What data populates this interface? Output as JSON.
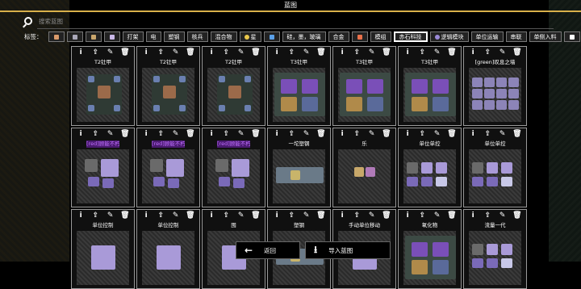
{
  "window": {
    "title": "蓝图"
  },
  "search": {
    "placeholder": "搜索蓝图"
  },
  "tags": {
    "label": "标签：",
    "items": [
      {
        "kind": "icon",
        "icon": "copper-icon",
        "text": "",
        "color": "#d99a6a"
      },
      {
        "kind": "icon",
        "icon": "lead-icon",
        "text": "",
        "color": "#a9a7b8"
      },
      {
        "kind": "icon",
        "icon": "metaglass-icon",
        "text": "",
        "color": "#c9a56c"
      },
      {
        "kind": "icon",
        "icon": "titanium-icon",
        "text": "",
        "color": "#c9b8e8"
      },
      {
        "kind": "text",
        "text": "打架"
      },
      {
        "kind": "text",
        "text": "电"
      },
      {
        "kind": "text",
        "text": "塑钢"
      },
      {
        "kind": "text",
        "text": "核兵"
      },
      {
        "kind": "text",
        "text": "混合物"
      },
      {
        "kind": "dot",
        "text": "星",
        "color": "#e9c74a"
      },
      {
        "kind": "icon",
        "icon": "water-icon",
        "text": "",
        "color": "#5aa0e8"
      },
      {
        "kind": "text",
        "text": "硅，墨，玻璃"
      },
      {
        "kind": "text",
        "text": "合金"
      },
      {
        "kind": "icon",
        "icon": "pyratite-icon",
        "text": "",
        "color": "#e8704a"
      },
      {
        "kind": "text",
        "text": "模组"
      },
      {
        "kind": "text",
        "text": "赤石科技",
        "active": true
      },
      {
        "kind": "icon-text",
        "icon": "logic-icon",
        "text": "逻辑模块",
        "color": "#9b8ad8"
      },
      {
        "kind": "text",
        "text": "单位运输"
      },
      {
        "kind": "text",
        "text": "串联"
      },
      {
        "kind": "text",
        "text": "单侧入料"
      },
      {
        "kind": "icon",
        "icon": "pencil-icon",
        "text": "",
        "color": "#ffffff"
      }
    ]
  },
  "toolbar_glyphs": {
    "info": "i",
    "upload": "⇪",
    "edit": "✎",
    "delete": "🗑"
  },
  "cards": [
    {
      "title": "T2钍甲",
      "purple": false,
      "preview": "plant"
    },
    {
      "title": "T2钍甲",
      "purple": false,
      "preview": "plant"
    },
    {
      "title": "T2钍甲",
      "purple": false,
      "preview": "plant"
    },
    {
      "title": "T3钍甲",
      "purple": false,
      "preview": "big"
    },
    {
      "title": "T3钍甲",
      "purple": false,
      "preview": "big"
    },
    {
      "title": "T3钍甲",
      "purple": false,
      "preview": "big"
    },
    {
      "title": "[green]叹息之墙",
      "purple": false,
      "preview": "wall"
    },
    {
      "title": "[red]顾能不朽[]",
      "purple": true,
      "preview": "logic"
    },
    {
      "title": "[red]顾能不朽[]",
      "purple": true,
      "preview": "logic"
    },
    {
      "title": "[red]顾能不朽[]",
      "purple": true,
      "preview": "logic"
    },
    {
      "title": "一坨塑钢",
      "purple": false,
      "preview": "plastanium"
    },
    {
      "title": "乐",
      "purple": false,
      "preview": "small"
    },
    {
      "title": "单位单控",
      "purple": false,
      "preview": "unit"
    },
    {
      "title": "单位单控",
      "purple": false,
      "preview": "unit"
    },
    {
      "title": "单位控制",
      "purple": false,
      "preview": "crystal"
    },
    {
      "title": "单位控制",
      "purple": false,
      "preview": "crystal"
    },
    {
      "title": "囤",
      "purple": false,
      "preview": "crystal"
    },
    {
      "title": "塑钢",
      "purple": false,
      "preview": "plastanium"
    },
    {
      "title": "手动单位移动",
      "purple": false,
      "preview": "crystal"
    },
    {
      "title": "氧化物",
      "purple": false,
      "preview": "big"
    },
    {
      "title": "流量一代",
      "purple": false,
      "preview": "unit"
    }
  ],
  "bottom": {
    "back_label": "返回",
    "back_icon": "←",
    "import_label": "导入蓝图",
    "import_icon": "⭳"
  }
}
